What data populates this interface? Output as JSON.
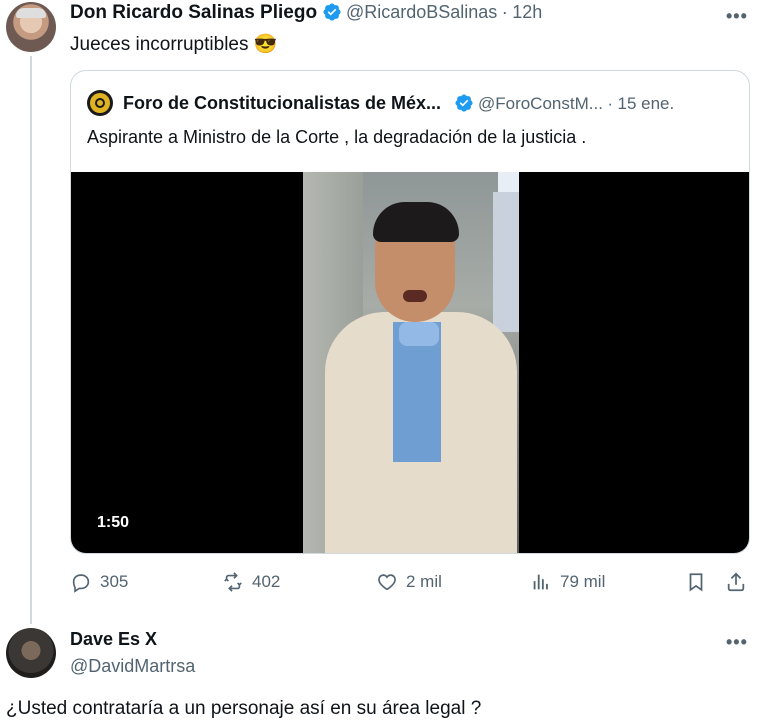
{
  "tweet": {
    "author_name": "Don Ricardo Salinas Pliego",
    "handle": "@RicardoBSalinas",
    "separator": "·",
    "time": "12h",
    "text": "Jueces incorruptibles",
    "emoji": "😎",
    "more": "•••"
  },
  "quoted": {
    "author_name": "Foro de Constitucionalistas de Méx...",
    "handle": "@ForoConstM...",
    "separator": "·",
    "date": "15 ene.",
    "text": "Aspirante a Ministro de la Corte , la degradación de la justicia .",
    "video_duration": "1:50"
  },
  "actions": {
    "replies": "305",
    "reposts": "402",
    "likes": "2 mil",
    "views": "79 mil"
  },
  "reply": {
    "author_name": "Dave Es X",
    "handle": "@DavidMartrsa",
    "more": "•••",
    "text": "¿Usted contrataría a un personaje así en su área legal ?"
  },
  "colors": {
    "verified": "#1d9bf0",
    "muted": "#536471",
    "border": "#cfd9de"
  }
}
